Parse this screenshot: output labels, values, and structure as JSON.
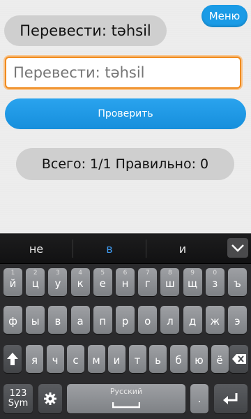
{
  "header": {
    "menu_label": "Меню"
  },
  "quiz": {
    "prompt": "Перевести: təhsil",
    "input_placeholder": "Перевести: təhsil",
    "check_label": "Проверить",
    "score": "Всего: 1/1 Правильно: 0"
  },
  "keyboard": {
    "suggestions": [
      "не",
      "в",
      "и"
    ],
    "row1": [
      {
        "k": "й",
        "h": "1"
      },
      {
        "k": "ц",
        "h": "2"
      },
      {
        "k": "у",
        "h": "3"
      },
      {
        "k": "к",
        "h": "4"
      },
      {
        "k": "е",
        "h": "5"
      },
      {
        "k": "н",
        "h": "6"
      },
      {
        "k": "г",
        "h": "7"
      },
      {
        "k": "ш",
        "h": "8"
      },
      {
        "k": "щ",
        "h": "9"
      },
      {
        "k": "з",
        "h": "0"
      },
      {
        "k": "ъ",
        "h": ""
      }
    ],
    "row2": [
      "ф",
      "ы",
      "в",
      "а",
      "п",
      "р",
      "о",
      "л",
      "д",
      "ж",
      "э"
    ],
    "row3": [
      "я",
      "ч",
      "с",
      "м",
      "и",
      "т",
      "ь",
      "б",
      "ю",
      "ё"
    ],
    "sym_label": "123\nSym",
    "space_label": "Русский",
    "colors": {
      "accent": "#1a9be6",
      "focus": "#f08b1f",
      "suggestion_active": "#3f9bf0"
    }
  }
}
